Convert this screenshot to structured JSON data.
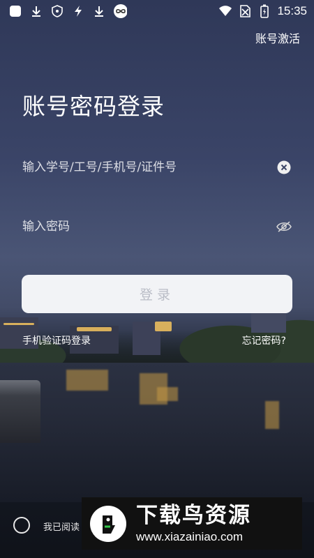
{
  "status_bar": {
    "time": "15:35",
    "icons": [
      "app-icon",
      "download-icon",
      "shield-icon",
      "bolt-icon",
      "download-icon",
      "infinity-icon",
      "wifi-icon",
      "no-sim-icon",
      "battery-icon"
    ]
  },
  "header": {
    "activate_label": "账号激活",
    "title": "账号密码登录"
  },
  "form": {
    "account_placeholder": "输入学号/工号/手机号/证件号",
    "account_value": "",
    "password_placeholder": "输入密码",
    "password_value": "",
    "login_label": "登录"
  },
  "links": {
    "sms_login": "手机验证码登录",
    "forgot_password": "忘记密码?"
  },
  "agreement": {
    "text": "我已阅读"
  },
  "watermark": {
    "title": "下载鸟资源",
    "url": "www.xiazainiao.com"
  }
}
